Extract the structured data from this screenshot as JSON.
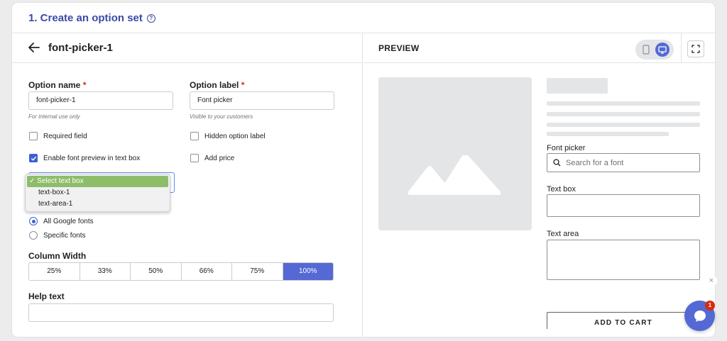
{
  "section": {
    "title": "1. Create an option set"
  },
  "editor": {
    "set_name": "font-picker-1",
    "option_name": {
      "label": "Option name",
      "required_mark": "*",
      "value": "font-picker-1",
      "hint": "For internal use only"
    },
    "option_label": {
      "label": "Option label",
      "required_mark": "*",
      "value": "Font picker",
      "hint": "Visible to your customers"
    },
    "checkboxes": [
      {
        "label": "Required field",
        "checked": false
      },
      {
        "label": "Hidden option label",
        "checked": false
      },
      {
        "label": "Enable font preview in text box",
        "checked": true
      },
      {
        "label": "Add price",
        "checked": false
      }
    ],
    "text_box_select": {
      "options": [
        "✓ Select text box",
        "text-box-1",
        "text-area-1"
      ],
      "selected": "Select text box"
    },
    "font_source": [
      {
        "label": "All Google fonts",
        "selected": true
      },
      {
        "label": "Specific fonts",
        "selected": false
      }
    ],
    "column_width": {
      "label": "Column Width",
      "options": [
        "25%",
        "33%",
        "50%",
        "66%",
        "75%",
        "100%"
      ],
      "selected": "100%"
    },
    "help_text": {
      "label": "Help text",
      "value": ""
    }
  },
  "preview": {
    "title": "PREVIEW",
    "font_picker_label": "Font picker",
    "search_placeholder": "Search for a font",
    "text_box_label": "Text box",
    "text_area_label": "Text area",
    "cart_button": "ADD TO CART"
  },
  "chat": {
    "badge": "1",
    "close": "×"
  },
  "colors": {
    "accent": "#5469d4",
    "title": "#3b4aa5",
    "required": "#d72c0d",
    "dropdown_selected": "#8ebd6a"
  }
}
